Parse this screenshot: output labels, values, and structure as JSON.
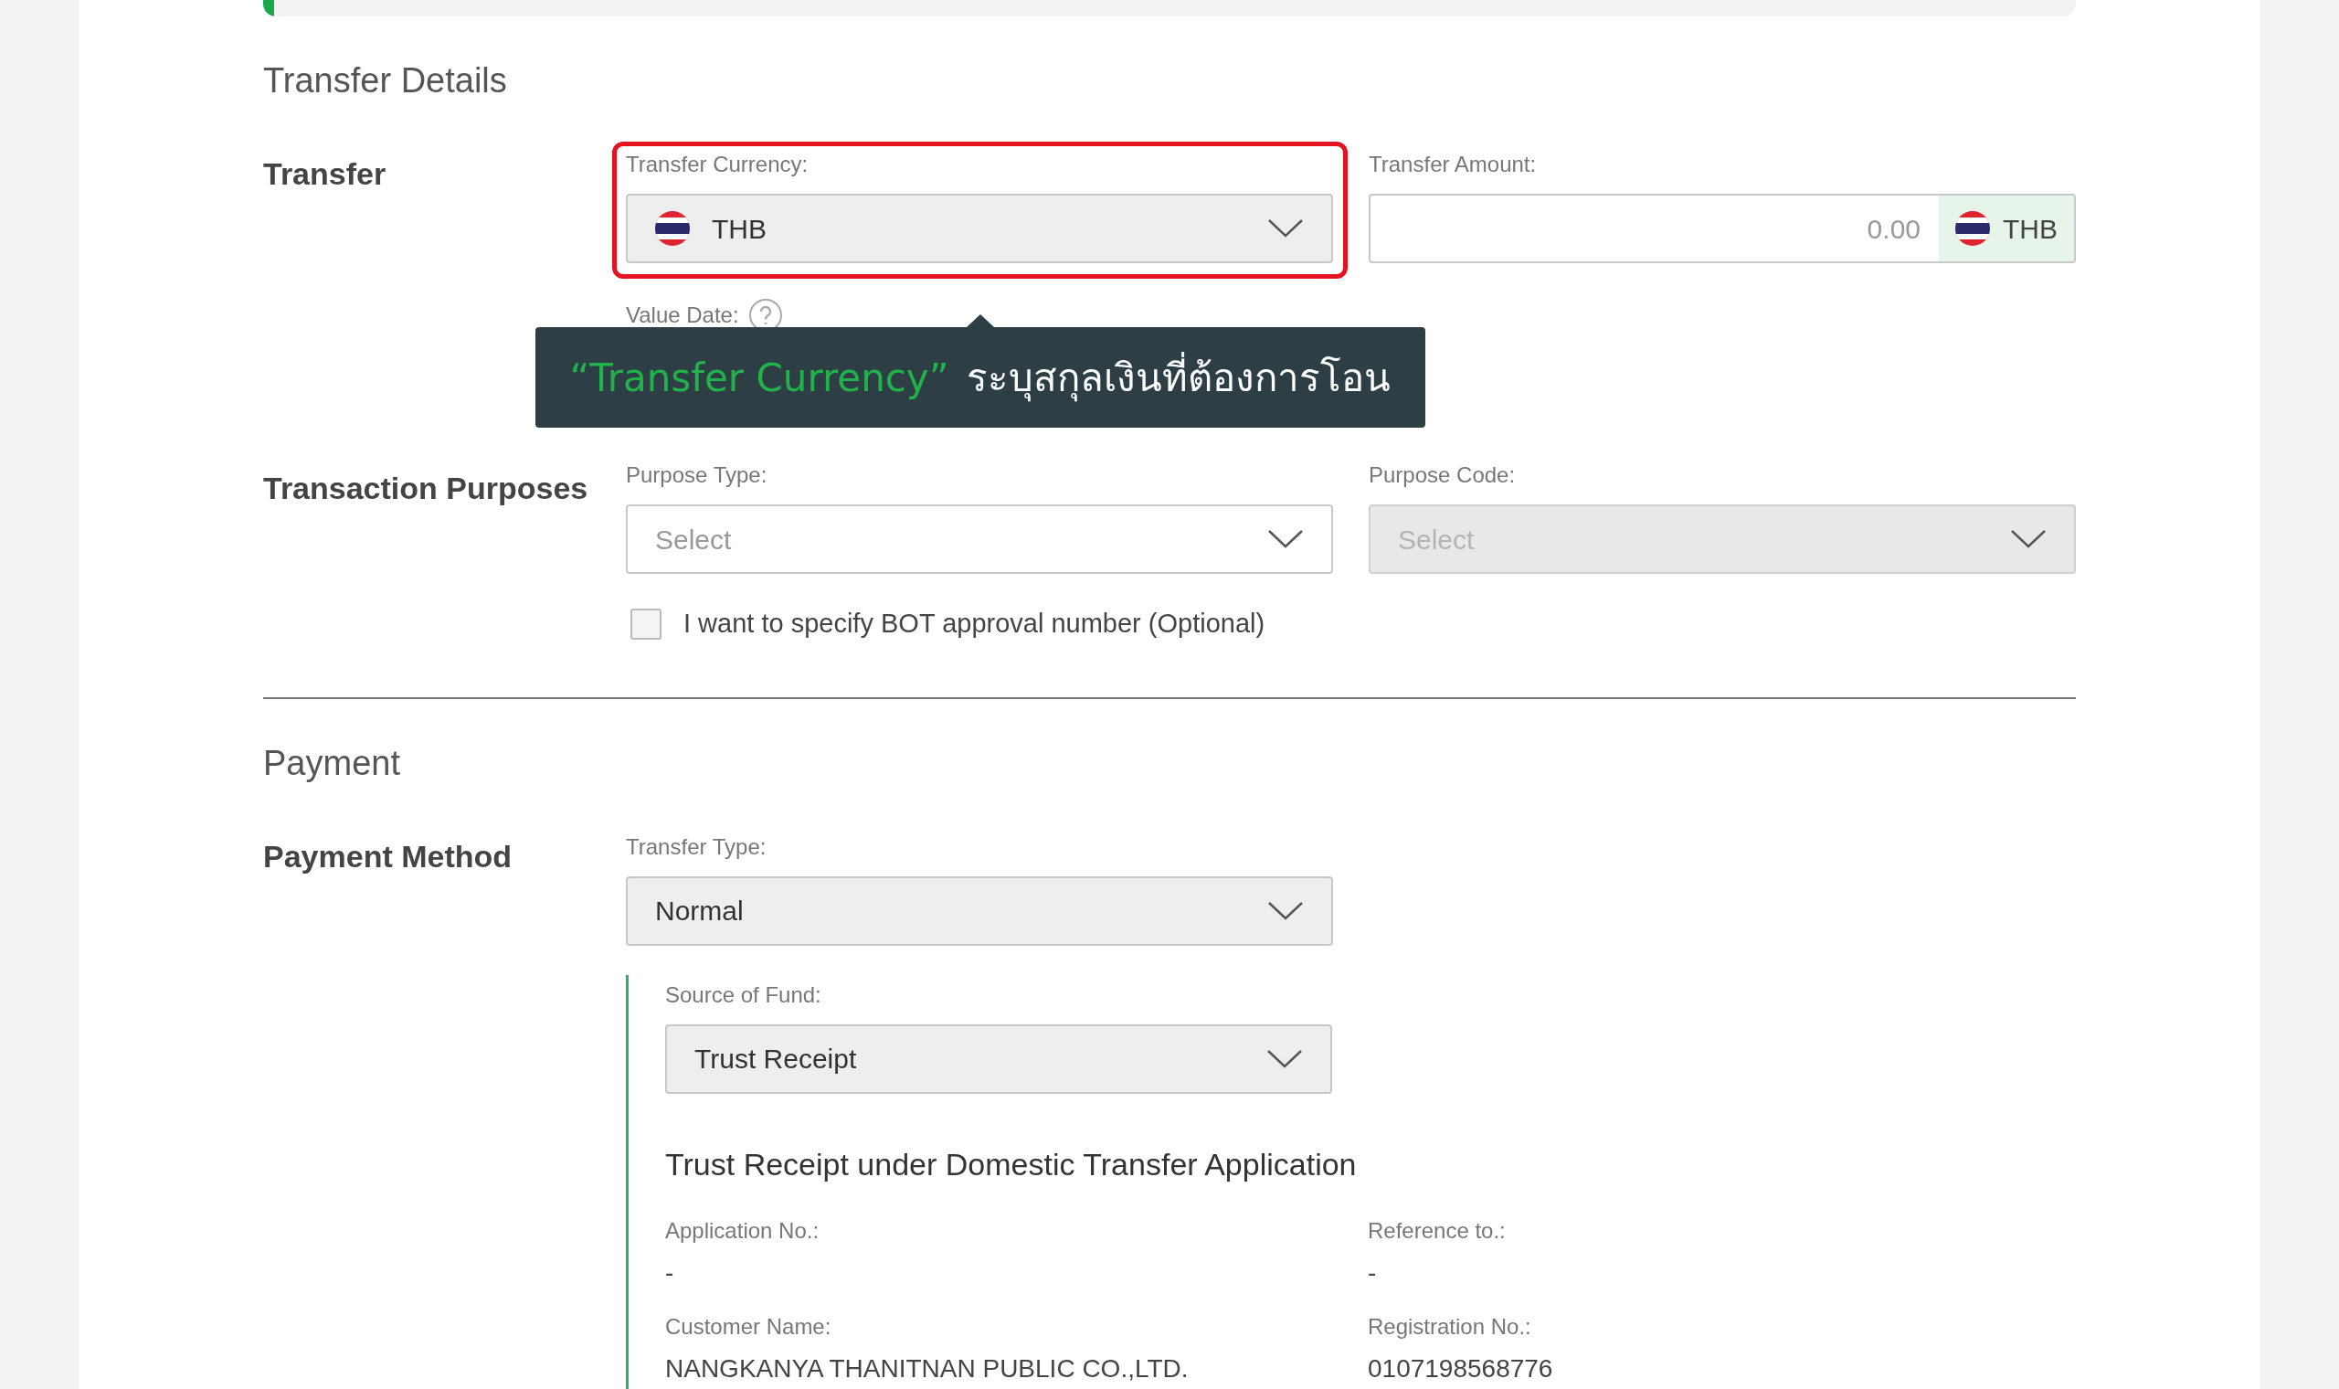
{
  "progress": {
    "level": 0.006
  },
  "transfer_details": {
    "title": "Transfer Details",
    "transfer": {
      "label": "Transfer",
      "currency": {
        "label": "Transfer Currency:",
        "value": "THB",
        "highlighted": true
      },
      "amount": {
        "label": "Transfer Amount:",
        "placeholder": "0.00",
        "currency": "THB"
      },
      "value_date": {
        "label": "Value Date:"
      }
    },
    "tooltip": {
      "highlight": "“Transfer Currency”",
      "text": "ระบุสกุลเงินที่ต้องการโอน"
    },
    "purposes": {
      "label": "Transaction Purposes",
      "selects": [
        {
          "label": "Purpose Type:",
          "placeholder": "Select",
          "disabled": false
        },
        {
          "label": "Purpose Code:",
          "placeholder": "Select",
          "disabled": true
        }
      ],
      "bot_checkbox": {
        "label": "I want to specify BOT approval number (Optional)",
        "checked": false
      }
    }
  },
  "payment": {
    "title": "Payment",
    "method_label": "Payment Method",
    "transfer_type": {
      "label": "Transfer Type:",
      "value": "Normal"
    },
    "source_of_fund": {
      "label": "Source of Fund:",
      "value": "Trust Receipt"
    },
    "application": {
      "title": "Trust Receipt under Domestic Transfer Application",
      "fields": [
        {
          "label": "Application No.:",
          "value": "-"
        },
        {
          "label": "Reference to.:",
          "value": "-"
        },
        {
          "label": "Customer Name:",
          "value": "NANGKANYA THANITNAN PUBLIC CO.,LTD."
        },
        {
          "label": "Registration No.:",
          "value": "0107198568776"
        }
      ]
    }
  }
}
